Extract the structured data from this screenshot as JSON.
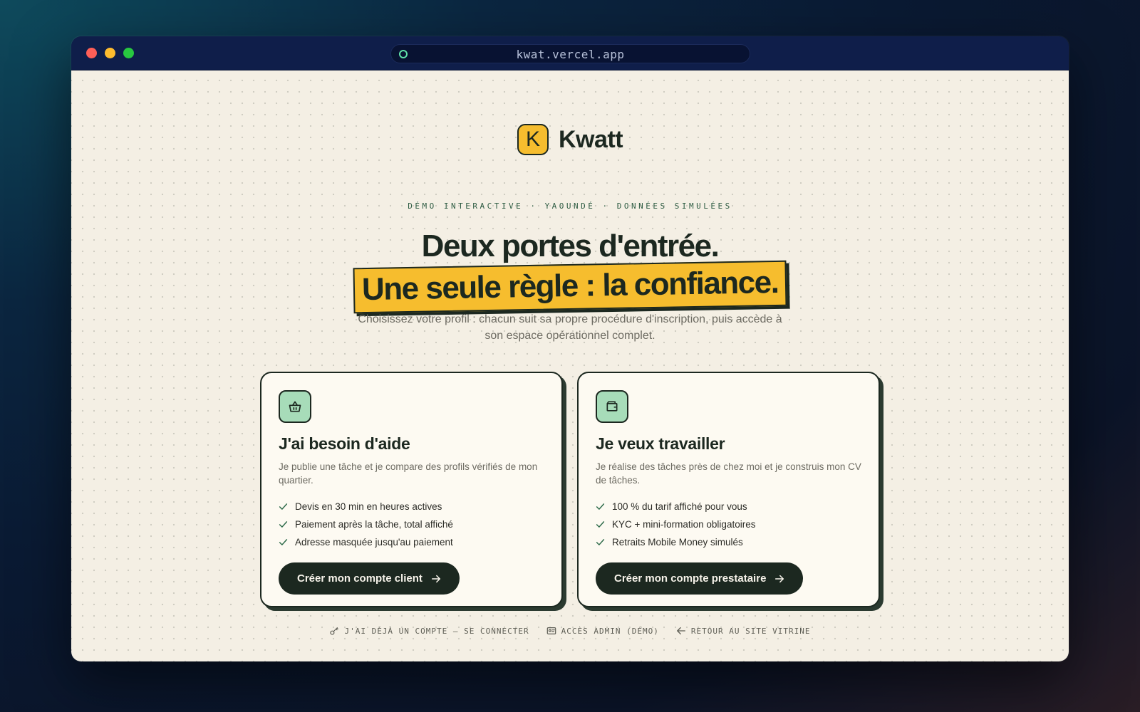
{
  "browser": {
    "url": "kwat.vercel.app"
  },
  "brand": {
    "logo_letter": "K",
    "name": "Kwatt",
    "accent_color": "#f6bd2e",
    "ink_color": "#1c2820",
    "mint_color": "#a7dcb9"
  },
  "hero": {
    "tagline": "DÉMO INTERACTIVE · YAOUNDÉ · DONNÉES SIMULÉES",
    "headline": "Deux portes d'entrée.",
    "highlight": "Une seule règle : la confiance.",
    "subtitle": "Choisissez votre profil : chacun suit sa propre procédure d'inscription, puis accède à son espace opérationnel complet."
  },
  "cards": {
    "client": {
      "icon": "basket-icon",
      "title": "J'ai besoin d'aide",
      "description": "Je publie une tâche et je compare des profils vérifiés de mon quartier.",
      "features": [
        "Devis en 30 min en heures actives",
        "Paiement après la tâche, total affiché",
        "Adresse masquée jusqu'au paiement"
      ],
      "cta": "Créer mon compte client"
    },
    "pro": {
      "icon": "wallet-icon",
      "title": "Je veux travailler",
      "description": "Je réalise des tâches près de chez moi et je construis mon CV de tâches.",
      "features": [
        "100 % du tarif affiché pour vous",
        "KYC + mini-formation obligatoires",
        "Retraits Mobile Money simulés"
      ],
      "cta": "Créer mon compte prestataire"
    }
  },
  "footer": {
    "login": "J'AI DÉJÀ UN COMPTE — SE CONNECTER",
    "admin": "ACCÈS ADMIN (DÉMO)",
    "back": "RETOUR AU SITE VITRINE"
  }
}
